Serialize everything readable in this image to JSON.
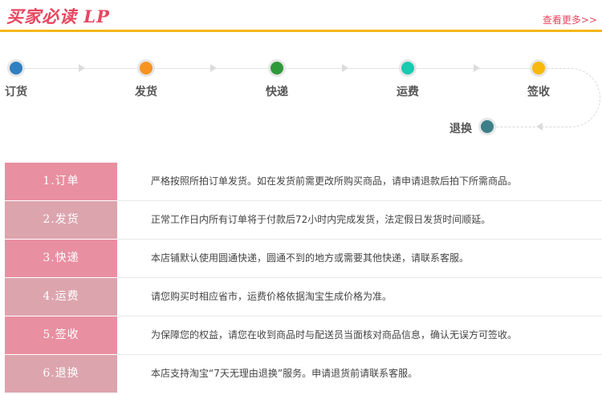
{
  "header": {
    "title": "买家必读 LP",
    "more_link": "查看更多>>"
  },
  "flow": {
    "steps": [
      {
        "label": "订货",
        "color": "#2f7fc1"
      },
      {
        "label": "发货",
        "color": "#f7931e"
      },
      {
        "label": "快递",
        "color": "#2e9a3a"
      },
      {
        "label": "运费",
        "color": "#19c9b0"
      },
      {
        "label": "签收",
        "color": "#f7b90c"
      }
    ],
    "return_step": {
      "label": "退换",
      "color": "#3c7f88"
    }
  },
  "rows": [
    {
      "label": "1.订单",
      "text": "严格按照所拍订单发货。如在发货前需更改所购买商品，请申请退款后拍下所需商品。",
      "color": "#e88fa1"
    },
    {
      "label": "2.发货",
      "text": "正常工作日内所有订单将于付款后72小时内完成发货，法定假日发货时间顺延。",
      "color": "#dca4ad"
    },
    {
      "label": "3.快递",
      "text": "本店铺默认使用圆通快递，圆通不到的地方或需要其他快递，请联系客服。",
      "color": "#e88fa1"
    },
    {
      "label": "4.运费",
      "text": "请您购买时相应省市，运费价格依据淘宝生成价格为准。",
      "color": "#dca4ad"
    },
    {
      "label": "5.签收",
      "text": "为保障您的权益，请您在收到商品时与配送员当面核对商品信息，确认无误方可签收。",
      "color": "#e88fa1"
    },
    {
      "label": "6.退换",
      "text": "本店支持淘宝“7天无理由退换”服务。申请退货前请联系客服。",
      "color": "#dca4ad"
    }
  ]
}
